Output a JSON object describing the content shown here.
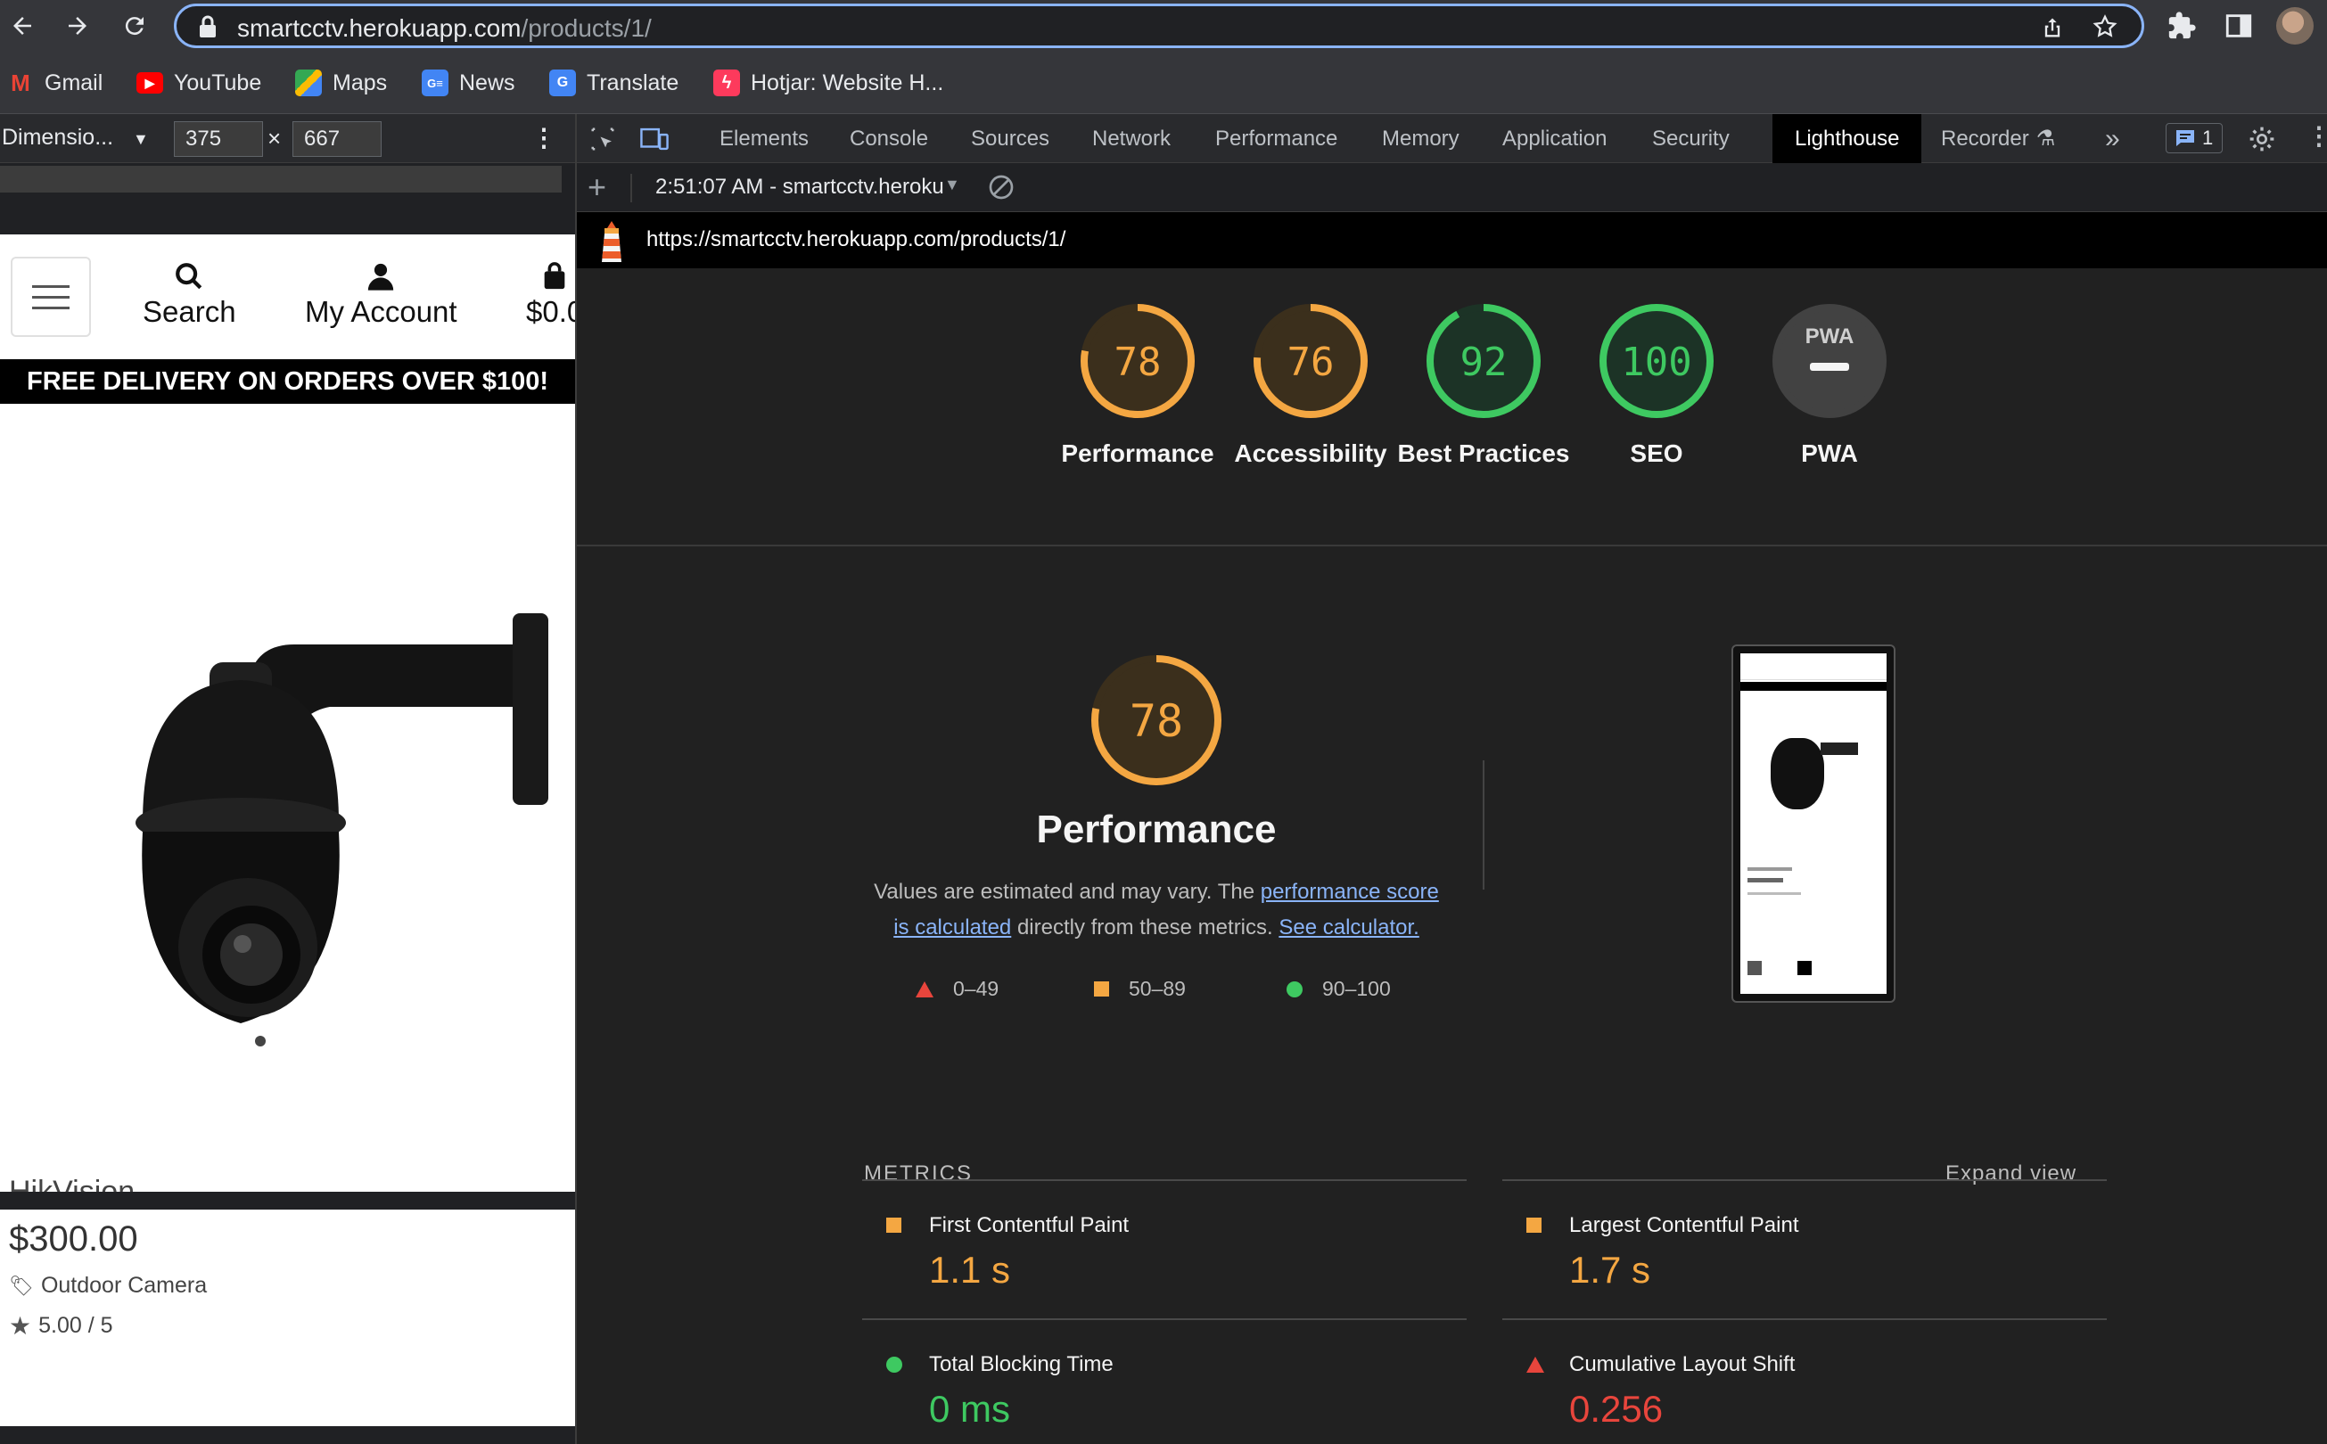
{
  "browser": {
    "url_host": "smartcctv.herokuapp.com",
    "url_path": "/products/1/",
    "bookmarks": [
      {
        "label": "Gmail",
        "icon": "gmail-icon"
      },
      {
        "label": "YouTube",
        "icon": "youtube-icon"
      },
      {
        "label": "Maps",
        "icon": "maps-icon"
      },
      {
        "label": "News",
        "icon": "news-icon"
      },
      {
        "label": "Translate",
        "icon": "translate-icon"
      },
      {
        "label": "Hotjar: Website H...",
        "icon": "hotjar-icon"
      }
    ]
  },
  "device_toolbar": {
    "dimensions_label": "Dimensio...",
    "width": "375",
    "height": "667",
    "times": "×"
  },
  "mobile_page": {
    "header": {
      "search_label": "Search",
      "account_label": "My Account",
      "cart_label": "$0.0"
    },
    "banner": "FREE DELIVERY ON ORDERS OVER $100!",
    "product": {
      "brand": "HikVision",
      "price": "$300.00",
      "category": "Outdoor Camera",
      "rating": "5.00 / 5"
    }
  },
  "devtools": {
    "tabs": [
      "Elements",
      "Console",
      "Sources",
      "Network",
      "Performance",
      "Memory",
      "Application",
      "Security",
      "Lighthouse",
      "Recorder"
    ],
    "active_tab": "Lighthouse",
    "overflow": "»",
    "issues_count": "1",
    "report_selector": "2:51:07 AM - smartcctv.heroku",
    "report_url": "https://smartcctv.herokuapp.com/products/1/"
  },
  "lighthouse": {
    "scores": [
      {
        "label": "Performance",
        "value": "78",
        "fraction": 0.78,
        "status": "average"
      },
      {
        "label": "Accessibility",
        "value": "76",
        "fraction": 0.76,
        "status": "average"
      },
      {
        "label": "Best Practices",
        "value": "92",
        "fraction": 0.92,
        "status": "pass"
      },
      {
        "label": "SEO",
        "value": "100",
        "fraction": 1.0,
        "status": "pass"
      },
      {
        "label": "PWA",
        "value": "PWA",
        "fraction": 0,
        "status": "na"
      }
    ],
    "detail": {
      "score": "78",
      "fraction": 0.78,
      "title": "Performance",
      "desc_1": "Values are estimated and may vary. The ",
      "link_1": "performance score is calculated",
      "desc_2": " directly from these metrics. ",
      "link_2": "See calculator.",
      "legend": [
        {
          "range": "0–49",
          "shape": "triangle",
          "color": "#e8453c"
        },
        {
          "range": "50–89",
          "shape": "square",
          "color": "#f4a742"
        },
        {
          "range": "90–100",
          "shape": "circle",
          "color": "#3ec961"
        }
      ]
    },
    "metrics_header": "METRICS",
    "expand_view": "Expand view",
    "metrics": [
      {
        "name": "First Contentful Paint",
        "value": "1.1 s",
        "status": "average"
      },
      {
        "name": "Largest Contentful Paint",
        "value": "1.7 s",
        "status": "average"
      },
      {
        "name": "Total Blocking Time",
        "value": "0 ms",
        "status": "pass"
      },
      {
        "name": "Cumulative Layout Shift",
        "value": "0.256",
        "status": "fail"
      }
    ],
    "colors": {
      "average": "#f4a742",
      "pass": "#3ec961",
      "fail": "#e8453c",
      "na": "#555555"
    }
  }
}
